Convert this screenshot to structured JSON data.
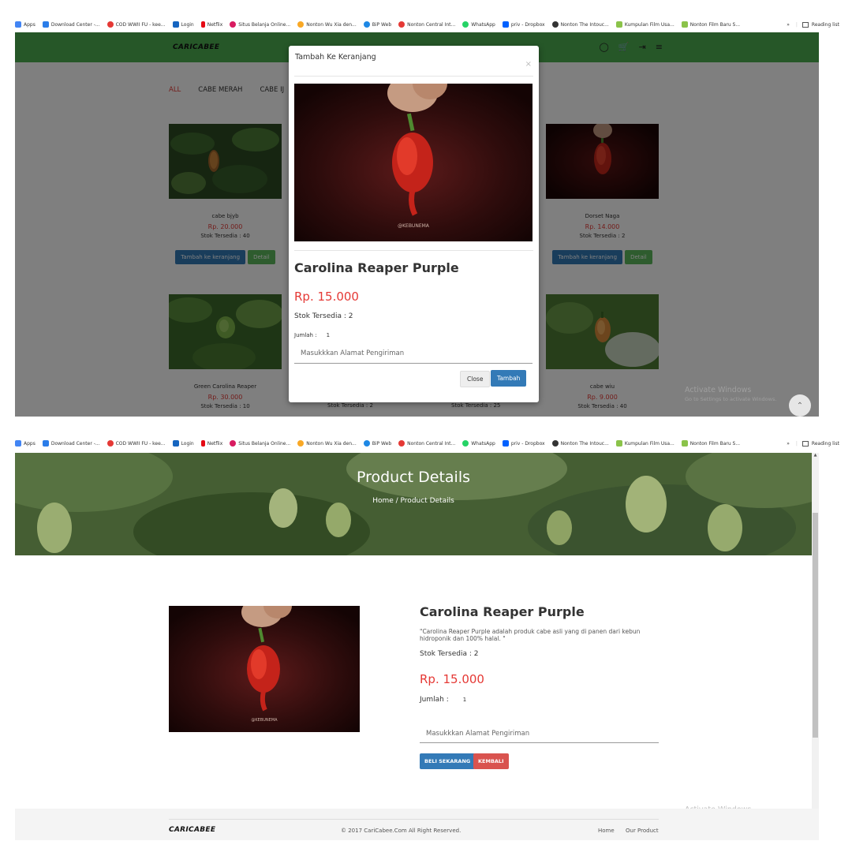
{
  "bookmarks": [
    {
      "label": "Apps",
      "color": "#4285f4"
    },
    {
      "label": "Download Center -...",
      "color": "#2b7de9"
    },
    {
      "label": "COD WWII FU - kee...",
      "color": "#e53935"
    },
    {
      "label": "Login",
      "color": "#1565c0"
    },
    {
      "label": "Netflix",
      "color": "#e50914"
    },
    {
      "label": "Situs Belanja Online...",
      "color": "#d81b60"
    },
    {
      "label": "Nonton Wu Xia den...",
      "color": "#f9a825"
    },
    {
      "label": "BiP Web",
      "color": "#1e88e5"
    },
    {
      "label": "Nonton Central Int...",
      "color": "#e53935"
    },
    {
      "label": "WhatsApp",
      "color": "#25d366"
    },
    {
      "label": "priv - Dropbox",
      "color": "#0061ff"
    },
    {
      "label": "Nonton The Intouc...",
      "color": "#333333"
    },
    {
      "label": "Kumpulan Film Usa...",
      "color": "#8bc34a"
    },
    {
      "label": "Nonton Film Baru S...",
      "color": "#8bc34a"
    }
  ],
  "bookmarks_overflow": "»",
  "reading_list": "Reading list",
  "shop": {
    "logo": "CARICABEE",
    "nav_icons": [
      "user-icon",
      "cart-icon",
      "logout-icon",
      "menu-icon"
    ],
    "categories": [
      "ALL",
      "CABE MERAH",
      "CABE IJ"
    ],
    "products": [
      {
        "name": "cabe bjyb",
        "price": "Rp. 20.000",
        "stock": "Stok Tersedia : 40",
        "add_label": "Tambah ke keranjang",
        "detail_label": "Detail"
      },
      {
        "name": "Dorset Naga",
        "price": "Rp. 14.000",
        "stock": "Stok Tersedia : 2",
        "add_label": "Tambah ke keranjang",
        "detail_label": "Detail"
      },
      {
        "name": "Green Carolina Reaper",
        "price": "Rp. 30.000",
        "stock": "Stok Tersedia : 10"
      },
      {
        "name": "cabe wiu",
        "price": "Rp. 9.000",
        "stock": "Stok Tersedia : 40"
      }
    ],
    "hidden_stocks": [
      "Stok Tersedia : 2",
      "Stok Tersedia : 25"
    ]
  },
  "modal": {
    "title": "Tambah Ke Keranjang",
    "close_x": "×",
    "image_caption": "@KEBUNEMA",
    "product_name": "Carolina Reaper Purple",
    "price": "Rp. 15.000",
    "stock": "Stok Tersedia : 2",
    "qty_label": "Jumlah :",
    "qty_value": "1",
    "address_placeholder": "Masukkkan Alamat Pengiriman",
    "close_label": "Close",
    "add_label": "Tambah"
  },
  "watermark": {
    "title": "Activate Windows",
    "subtitle": "Go to Settings to activate Windows."
  },
  "detail_page": {
    "hero_title": "Product Details",
    "breadcrumb": "Home  /  Product Details",
    "image_caption": "@KEBUNEMA",
    "product_name": "Carolina Reaper Purple",
    "description": "\"Carolina Reaper Purple adalah produk cabe asli yang di panen dari kebun hidroponik dan 100% halal. \"",
    "stock": "Stok Tersedia : 2",
    "price": "Rp. 15.000",
    "qty_label": "Jumlah :",
    "qty_value": "1",
    "address_placeholder": "Masukkkan Alamat Pengiriman",
    "buy_label": "BELI SEKARANG",
    "back_label": "KEMBALI"
  },
  "footer": {
    "logo": "CARICABEE",
    "copyright": "© 2017 CariCabee.Com All Right Reserved.",
    "links": [
      "Home",
      "Our Product"
    ]
  },
  "colors": {
    "navbar": "#4caf50",
    "accent_red": "#e53935",
    "primary_blue": "#337ab7",
    "success_green": "#5cb85c",
    "danger_red": "#d9534f"
  }
}
